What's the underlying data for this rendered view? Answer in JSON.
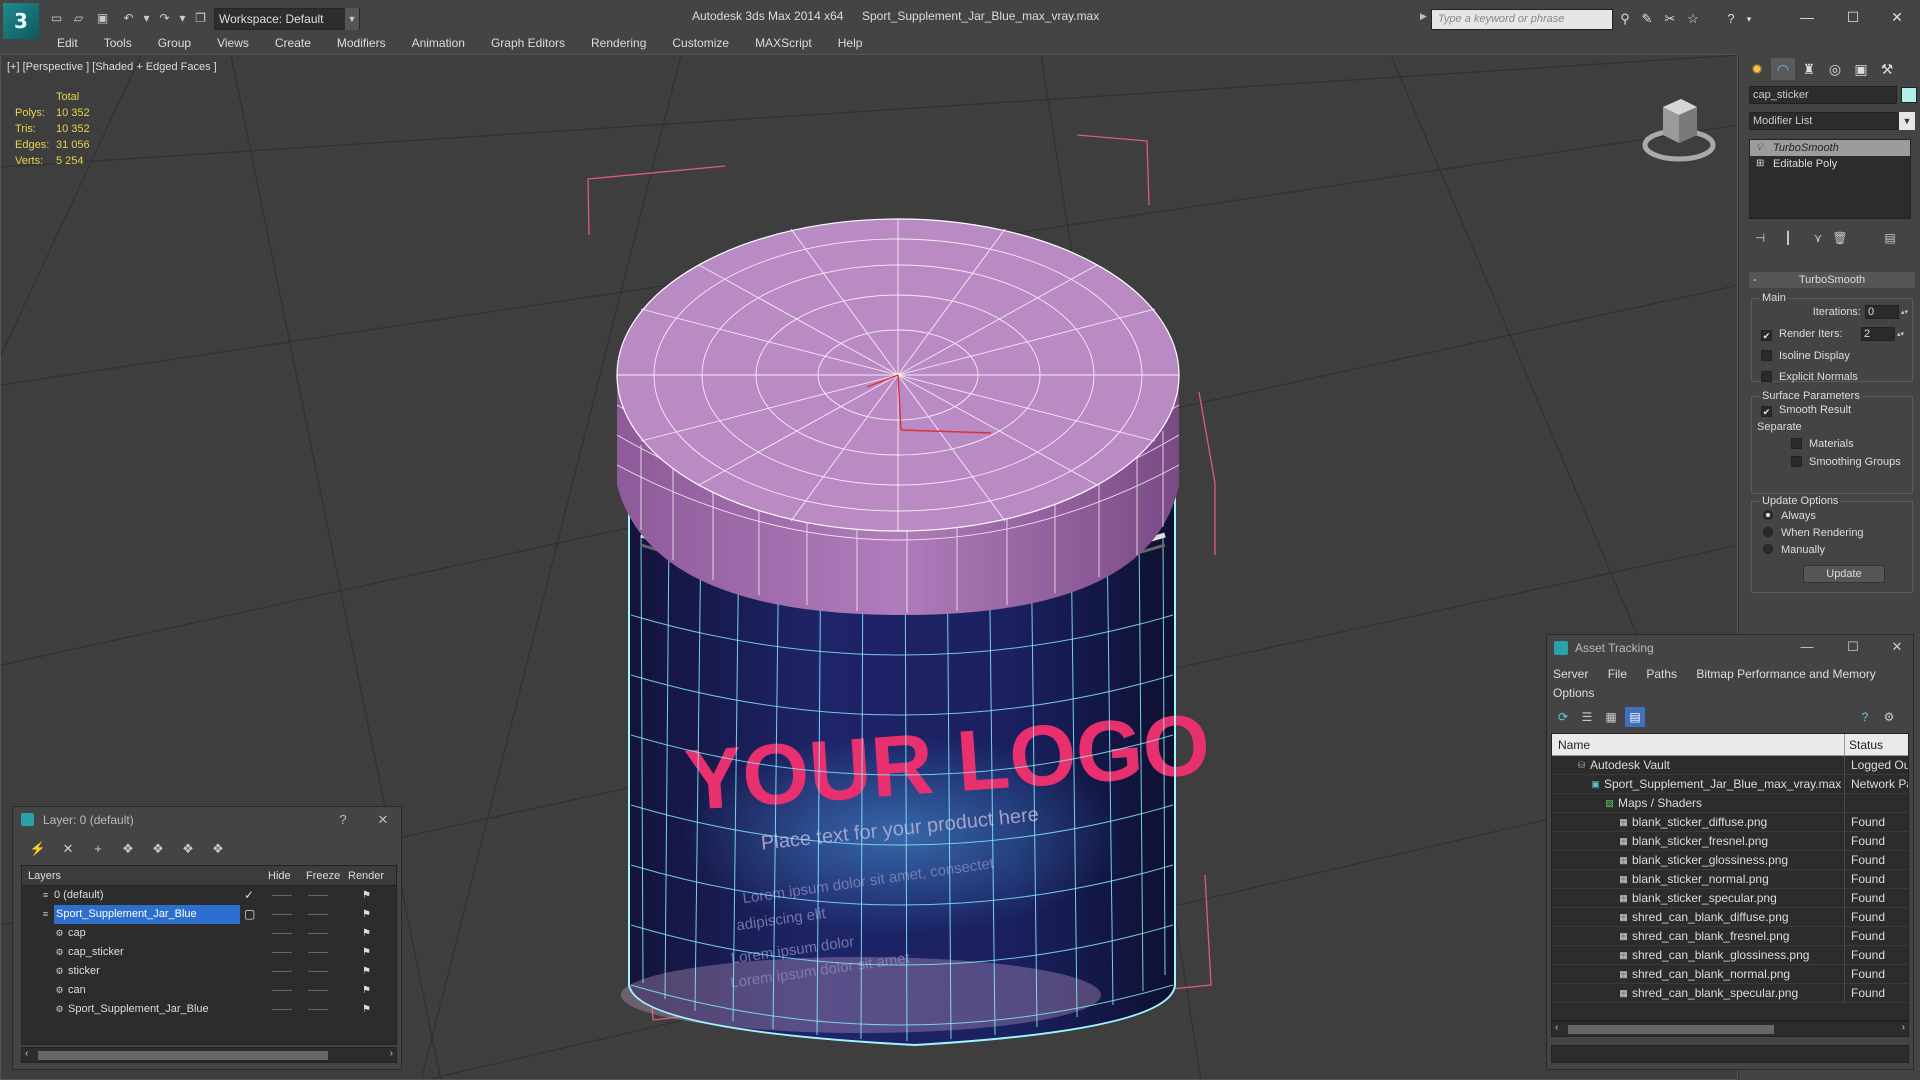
{
  "titlebar": {
    "logo": "3",
    "workspace": "Workspace: Default",
    "app_title": "Autodesk 3ds Max  2014 x64",
    "doc_title": "Sport_Supplement_Jar_Blue_max_vray.max",
    "search_placeholder": "Type a keyword or phrase",
    "minimize": "—",
    "maximize": "☐",
    "close": "✕"
  },
  "menu": [
    "Edit",
    "Tools",
    "Group",
    "Views",
    "Create",
    "Modifiers",
    "Animation",
    "Graph Editors",
    "Rendering",
    "Customize",
    "MAXScript",
    "Help"
  ],
  "viewport": {
    "label": "[+] [Perspective ] [Shaded + Edged Faces ]",
    "stats": {
      "total_label": "Total",
      "rows": [
        {
          "label": "Polys:",
          "value": "10 352"
        },
        {
          "label": "Tris:",
          "value": "10 352"
        },
        {
          "label": "Edges:",
          "value": "31 056"
        },
        {
          "label": "Verts:",
          "value": "5 254"
        }
      ]
    },
    "label_lines": [
      "YOUR LOGO",
      "Place text for your product here",
      "Lorem ipsum dolor sit amet, consectet",
      "adipiscing elit",
      "Lorem ipsum dolor",
      "Lorem ipsum dolor sit amet"
    ]
  },
  "command_panel": {
    "object_name": "cap_sticker",
    "object_color": "#b3efef",
    "modifier_list": "Modifier List",
    "stack": [
      "TurboSmooth",
      "Editable Poly"
    ],
    "rollout_title": "TurboSmooth",
    "main_group": "Main",
    "iterations_label": "Iterations:",
    "iterations_value": "0",
    "render_iters_label": "Render Iters:",
    "render_iters_value": "2",
    "isoline": "Isoline Display",
    "explicit_normals": "Explicit Normals",
    "surface_group": "Surface Parameters",
    "smooth_result": "Smooth Result",
    "separate": "Separate",
    "materials": "Materials",
    "smoothing_groups": "Smoothing Groups",
    "update_group": "Update Options",
    "always": "Always",
    "when_rendering": "When Rendering",
    "manually": "Manually",
    "update_button": "Update"
  },
  "asset_tracking": {
    "title": "Asset Tracking",
    "menu": [
      "Server",
      "File",
      "Paths",
      "Bitmap Performance and Memory",
      "Options"
    ],
    "col_name": "Name",
    "col_status": "Status",
    "rows": [
      {
        "name": "Autodesk Vault",
        "status": "Logged Out",
        "indent": 0,
        "icon": "vault-icon"
      },
      {
        "name": "Sport_Supplement_Jar_Blue_max_vray.max",
        "status": "Network Path",
        "indent": 1,
        "icon": "max-file-icon"
      },
      {
        "name": "Maps / Shaders",
        "status": "",
        "indent": 2,
        "icon": "maps-icon"
      },
      {
        "name": "blank_sticker_diffuse.png",
        "status": "Found",
        "indent": 3,
        "icon": "bitmap-icon"
      },
      {
        "name": "blank_sticker_fresnel.png",
        "status": "Found",
        "indent": 3,
        "icon": "bitmap-icon"
      },
      {
        "name": "blank_sticker_glossiness.png",
        "status": "Found",
        "indent": 3,
        "icon": "bitmap-icon"
      },
      {
        "name": "blank_sticker_normal.png",
        "status": "Found",
        "indent": 3,
        "icon": "bitmap-icon"
      },
      {
        "name": "blank_sticker_specular.png",
        "status": "Found",
        "indent": 3,
        "icon": "bitmap-icon"
      },
      {
        "name": "shred_can_blank_diffuse.png",
        "status": "Found",
        "indent": 3,
        "icon": "bitmap-icon"
      },
      {
        "name": "shred_can_blank_fresnel.png",
        "status": "Found",
        "indent": 3,
        "icon": "bitmap-icon"
      },
      {
        "name": "shred_can_blank_glossiness.png",
        "status": "Found",
        "indent": 3,
        "icon": "bitmap-icon"
      },
      {
        "name": "shred_can_blank_normal.png",
        "status": "Found",
        "indent": 3,
        "icon": "bitmap-icon"
      },
      {
        "name": "shred_can_blank_specular.png",
        "status": "Found",
        "indent": 3,
        "icon": "bitmap-icon"
      }
    ]
  },
  "layers": {
    "title": "Layer: 0 (default)",
    "help": "?",
    "col_layers": "Layers",
    "col_hide": "Hide",
    "col_freeze": "Freeze",
    "col_render": "Render",
    "rows": [
      {
        "name": "0 (default)",
        "indent": 1,
        "active": true,
        "selected": false
      },
      {
        "name": "Sport_Supplement_Jar_Blue",
        "indent": 1,
        "active": false,
        "selected": true
      },
      {
        "name": "cap",
        "indent": 2,
        "active": false,
        "selected": false
      },
      {
        "name": "cap_sticker",
        "indent": 2,
        "active": false,
        "selected": false
      },
      {
        "name": "sticker",
        "indent": 2,
        "active": false,
        "selected": false
      },
      {
        "name": "can",
        "indent": 2,
        "active": false,
        "selected": false
      },
      {
        "name": "Sport_Supplement_Jar_Blue",
        "indent": 2,
        "active": false,
        "selected": false
      }
    ]
  }
}
